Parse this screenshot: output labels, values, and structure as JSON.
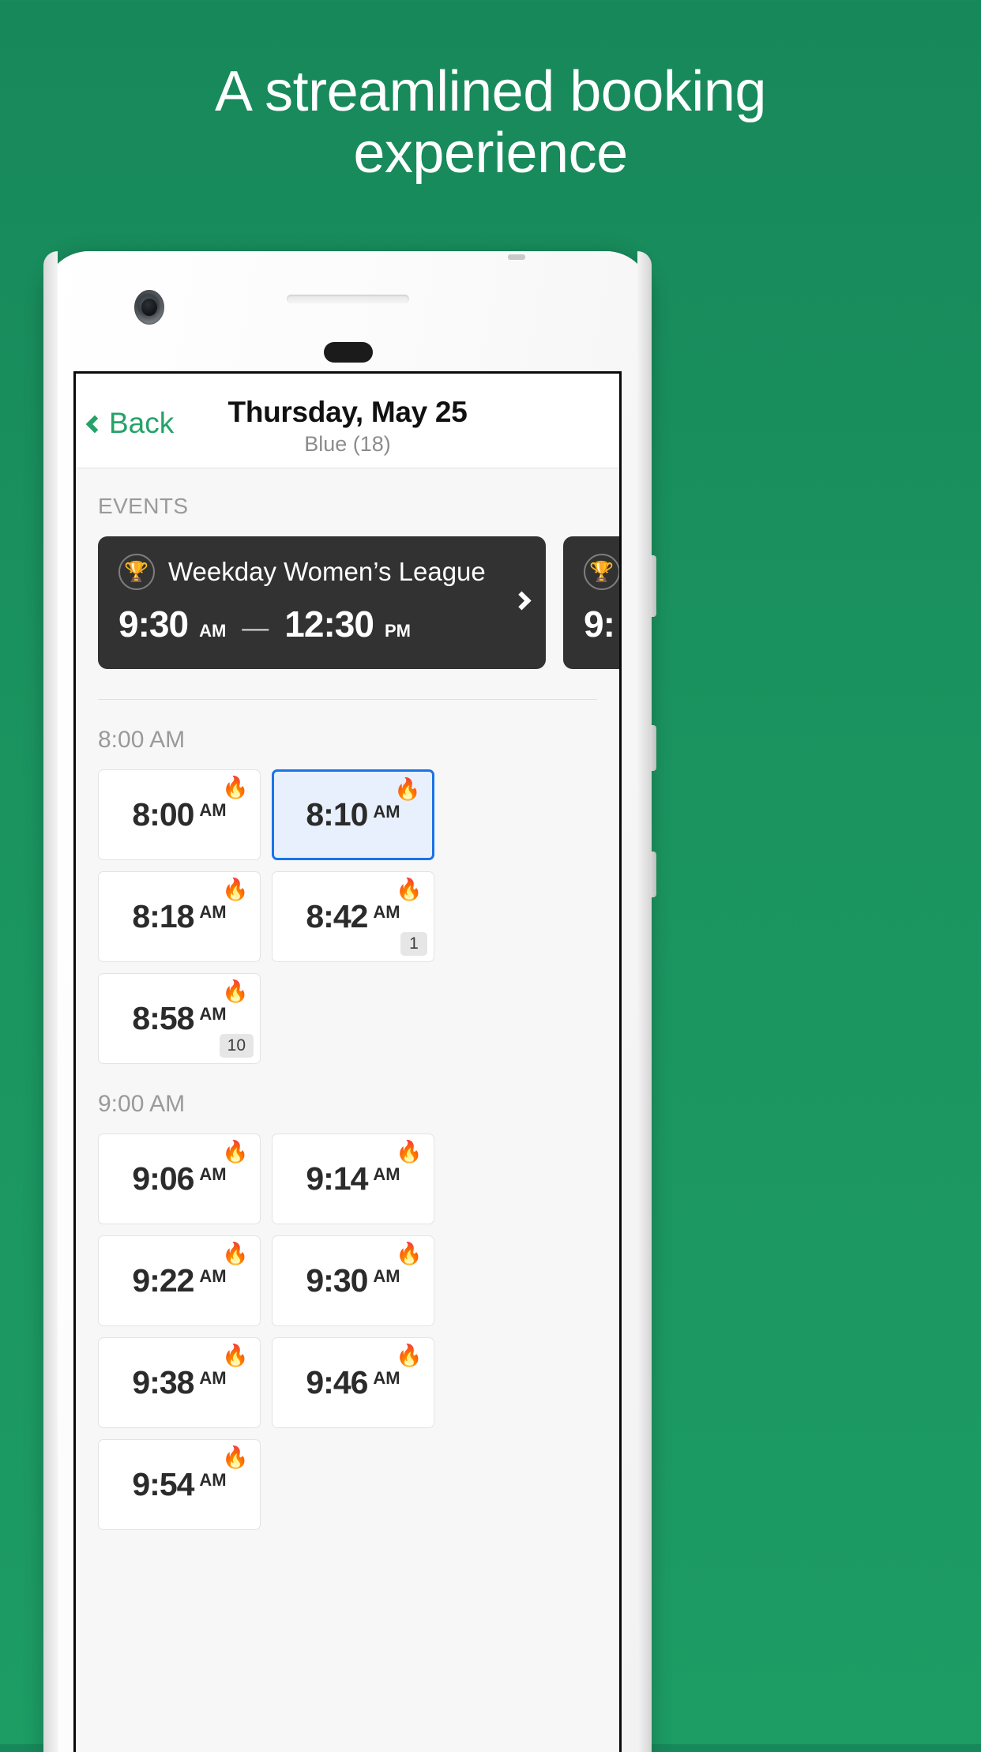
{
  "promo": {
    "headline_line1": "A streamlined booking",
    "headline_line2": "experience",
    "background_color": "#1b9460",
    "accent_color": "#26a269"
  },
  "app": {
    "nav": {
      "back_label": "Back",
      "back_icon": "chevron-left-icon",
      "title": "Thursday, May 25",
      "subtitle": "Blue (18)"
    },
    "events_section": {
      "label": "EVENTS",
      "cards": [
        {
          "icon": "trophy-icon",
          "name": "Weekday Women’s League",
          "start_time": "9:30",
          "start_meridiem": "AM",
          "separator": "—",
          "end_time": "12:30",
          "end_meridiem": "PM",
          "chevron": "chevron-right-icon"
        },
        {
          "icon": "trophy-icon",
          "name": "",
          "start_time": "9:",
          "start_meridiem": "",
          "separator": "",
          "end_time": "",
          "end_meridiem": "",
          "chevron": ""
        }
      ]
    },
    "slot_groups": [
      {
        "heading": "8:00 AM",
        "slots": [
          {
            "time": "8:00",
            "meridiem": "AM",
            "flame": "🔥",
            "badge": "",
            "selected": false
          },
          {
            "time": "8:10",
            "meridiem": "AM",
            "flame": "🔥",
            "badge": "",
            "selected": true
          },
          {
            "time": "8:18",
            "meridiem": "AM",
            "flame": "🔥",
            "badge": "",
            "selected": false
          },
          {
            "time": "8:42",
            "meridiem": "AM",
            "flame": "🔥",
            "badge": "1",
            "selected": false
          },
          {
            "time": "8:58",
            "meridiem": "AM",
            "flame": "🔥",
            "badge": "10",
            "selected": false
          }
        ]
      },
      {
        "heading": "9:00 AM",
        "slots": [
          {
            "time": "9:06",
            "meridiem": "AM",
            "flame": "🔥",
            "badge": "",
            "selected": false
          },
          {
            "time": "9:14",
            "meridiem": "AM",
            "flame": "🔥",
            "badge": "",
            "selected": false
          },
          {
            "time": "9:22",
            "meridiem": "AM",
            "flame": "🔥",
            "badge": "",
            "selected": false
          },
          {
            "time": "9:30",
            "meridiem": "AM",
            "flame": "🔥",
            "badge": "",
            "selected": false
          },
          {
            "time": "9:38",
            "meridiem": "AM",
            "flame": "🔥",
            "badge": "",
            "selected": false
          },
          {
            "time": "9:46",
            "meridiem": "AM",
            "flame": "🔥",
            "badge": "",
            "selected": false
          },
          {
            "time": "9:54",
            "meridiem": "AM",
            "flame": "🔥",
            "badge": "",
            "selected": false
          }
        ]
      }
    ]
  }
}
